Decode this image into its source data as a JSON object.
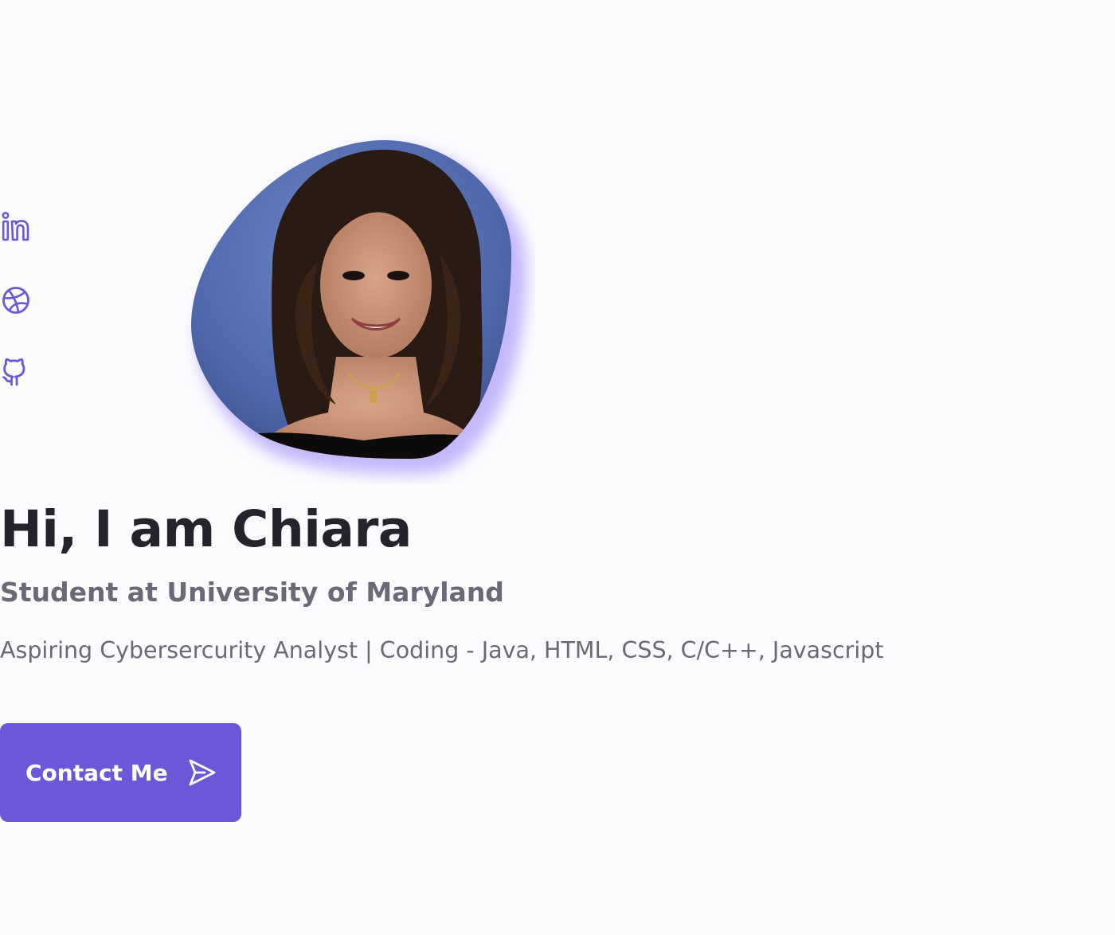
{
  "social": {
    "items": [
      {
        "name": "linkedin",
        "icon": "linkedin-icon"
      },
      {
        "name": "dribbble",
        "icon": "dribbble-icon"
      },
      {
        "name": "github",
        "icon": "github-icon"
      }
    ]
  },
  "profile": {
    "photo": "profile-photo"
  },
  "hero": {
    "greeting": "Hi, I am Chiara",
    "subtitle": "Student at University of Maryland",
    "description": "Aspiring Cybersercurity Analyst | Coding - Java, HTML, CSS, C/C++, Javascript"
  },
  "contact": {
    "label": "Contact Me",
    "icon": "send-icon"
  },
  "colors": {
    "accent": "#6c57d8",
    "background": "#fbfbfd",
    "heading": "#25232b",
    "muted": "#6b6877",
    "blob_shadow": "#c9befc"
  }
}
